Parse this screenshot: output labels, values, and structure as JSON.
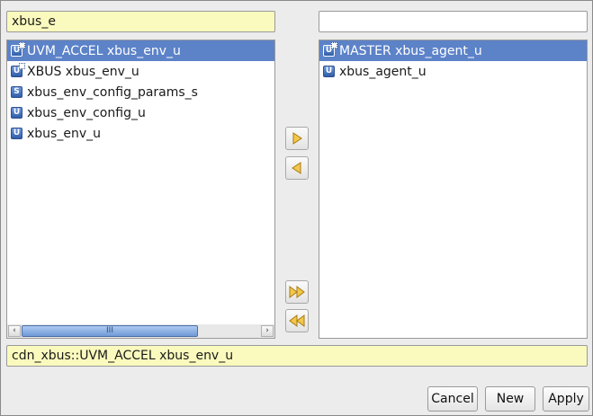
{
  "left_filter": {
    "value": "xbus_e"
  },
  "right_filter": {
    "value": ""
  },
  "left_list": {
    "items": [
      {
        "label": "UVM_ACCEL xbus_env_u",
        "icon": "unit-plus-icon",
        "selected": true
      },
      {
        "label": "XBUS xbus_env_u",
        "icon": "unit-plus-icon",
        "selected": false
      },
      {
        "label": "xbus_env_config_params_s",
        "icon": "struct-icon",
        "selected": false
      },
      {
        "label": "xbus_env_config_u",
        "icon": "unit-icon",
        "selected": false
      },
      {
        "label": "xbus_env_u",
        "icon": "unit-icon",
        "selected": false
      }
    ],
    "scrollbar": {
      "left_arrow": "‹",
      "right_arrow": "›",
      "thumb_grip": "III"
    }
  },
  "right_list": {
    "items": [
      {
        "label": "MASTER xbus_agent_u",
        "icon": "unit-plus-icon",
        "selected": true
      },
      {
        "label": "xbus_agent_u",
        "icon": "unit-icon",
        "selected": false
      }
    ]
  },
  "icons": {
    "unit": "U",
    "struct": "S"
  },
  "selection_path": {
    "value": "cdn_xbus::UVM_ACCEL xbus_env_u"
  },
  "buttons": {
    "cancel": "Cancel",
    "new": "New",
    "apply": "Apply"
  },
  "colors": {
    "selection": "#5c82c8",
    "field_yellow": "#fafabe",
    "arrow_fill": "#f3c84a"
  }
}
